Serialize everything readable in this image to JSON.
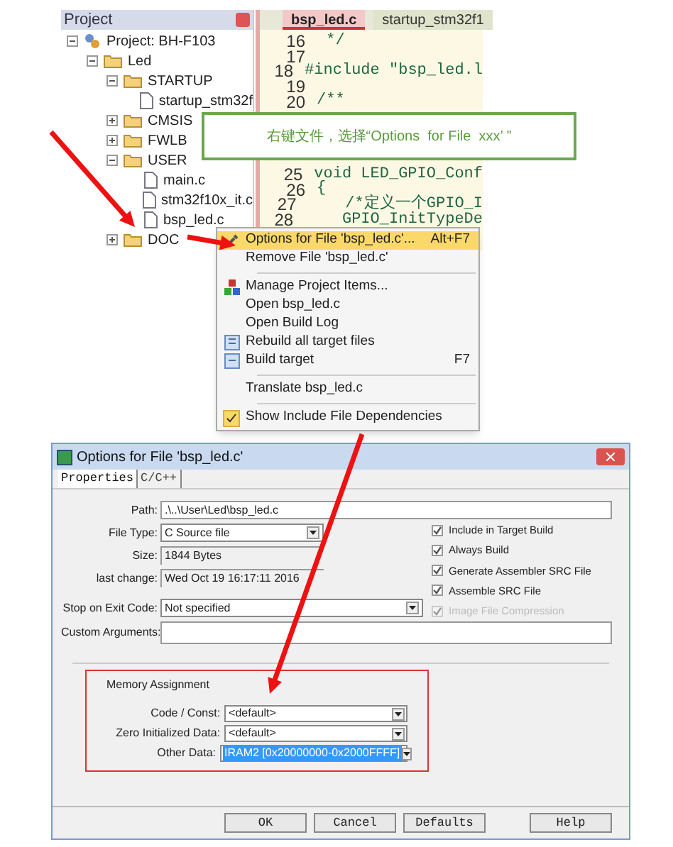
{
  "project_panel": {
    "title": "Project",
    "tree": [
      {
        "label": "Project: BH-F103",
        "kind": "project",
        "expanded": true,
        "children": [
          {
            "label": "Led",
            "kind": "target",
            "expanded": true,
            "children": [
              {
                "label": "STARTUP",
                "kind": "folder",
                "expanded": true,
                "children": [
                  {
                    "label": "startup_stm32f",
                    "kind": "file"
                  }
                ]
              },
              {
                "label": "CMSIS",
                "kind": "folder",
                "expanded": false
              },
              {
                "label": "FWLB",
                "kind": "folder",
                "expanded": false
              },
              {
                "label": "USER",
                "kind": "folder",
                "expanded": true,
                "children": [
                  {
                    "label": "main.c",
                    "kind": "file"
                  },
                  {
                    "label": "stm32f10x_it.c",
                    "kind": "file"
                  },
                  {
                    "label": "bsp_led.c",
                    "kind": "file"
                  }
                ]
              },
              {
                "label": "DOC",
                "kind": "folder",
                "expanded": false
              }
            ]
          }
        ]
      }
    ]
  },
  "editor": {
    "tabs": [
      {
        "label": "bsp_led.c",
        "selected": true
      },
      {
        "label": "startup_stm32f1",
        "selected": false
      }
    ],
    "code_top": [
      {
        "line": "16",
        "text": " */"
      },
      {
        "line": "17"
      },
      {
        "line": "18",
        "text": "#include \"bsp_led.l"
      },
      {
        "line": "19"
      },
      {
        "line": "20",
        "text": "/**"
      }
    ],
    "code_bottom": [
      {
        "line": "25",
        "text": "void LED_GPIO_Conf"
      },
      {
        "line": "26",
        "text": "{"
      },
      {
        "line": "27",
        "text": "    /*定义一个GPIO_I"
      },
      {
        "line": "28",
        "text": "    GPIO_InitTypeDe"
      }
    ]
  },
  "callout": "右键文件，选择“Options  for File  xxx’ ”",
  "context_menu": [
    {
      "kind": "item",
      "label": "Options for File 'bsp_led.c'...",
      "shortcut": "Alt+F7",
      "selected": true
    },
    {
      "kind": "item",
      "label": "Remove File 'bsp_led.c'",
      "selected": false
    },
    {
      "kind": "separator"
    },
    {
      "kind": "item",
      "label": "Manage Project Items...",
      "selected": false
    },
    {
      "kind": "item",
      "label": "Open bsp_led.c",
      "selected": false
    },
    {
      "kind": "item",
      "label": "Open Build Log",
      "selected": false
    },
    {
      "kind": "item",
      "label": "Rebuild all target files",
      "selected": false
    },
    {
      "kind": "item",
      "label": "Build target",
      "shortcut": "F7",
      "selected": false
    },
    {
      "kind": "separator"
    },
    {
      "kind": "item",
      "label": "Translate bsp_led.c",
      "selected": false
    },
    {
      "kind": "separator"
    },
    {
      "kind": "check",
      "label": "Show Include File Dependencies",
      "checked": true,
      "selected": false
    }
  ],
  "dialog": {
    "title": "Options for File 'bsp_led.c'",
    "tabs": [
      {
        "label": "Properties",
        "selected": true
      },
      {
        "label": "C/C++",
        "selected": false
      }
    ],
    "fields": [
      {
        "label": "Path:",
        "value": ".\\..\\User\\Led\\bsp_led.c",
        "kind": "text"
      },
      {
        "label": "File Type:",
        "value": "C Source file",
        "kind": "select"
      },
      {
        "label": "Size:",
        "value": "1844 Bytes",
        "kind": "readonly"
      },
      {
        "label": "last change:",
        "value": "Wed Oct 19 16:17:11 2016",
        "kind": "readonly"
      },
      {
        "label": "Stop on Exit Code:",
        "value": "Not specified",
        "kind": "select"
      },
      {
        "label": "Custom Arguments:",
        "kind": "text"
      }
    ],
    "checkboxes": [
      {
        "label": "Include in Target Build",
        "checked": true,
        "disabled": false
      },
      {
        "label": "Always Build",
        "checked": true,
        "disabled": false
      },
      {
        "label": "Generate Assembler SRC File",
        "checked": true,
        "disabled": false
      },
      {
        "label": "Assemble SRC File",
        "checked": true,
        "disabled": false
      },
      {
        "label": "Image File Compression",
        "checked": true,
        "disabled": true
      }
    ],
    "memory": {
      "title": "Memory Assignment",
      "fields": [
        {
          "label": "Code / Const:",
          "value": "<default>",
          "selected": false
        },
        {
          "label": "Zero Initialized Data:",
          "value": "<default>",
          "selected": false
        },
        {
          "label": "Other Data:",
          "value": "IRAM2 [0x20000000-0x2000FFFF]",
          "selected": true
        }
      ]
    },
    "buttons": [
      "OK",
      "Cancel",
      "Defaults",
      "Help"
    ]
  }
}
